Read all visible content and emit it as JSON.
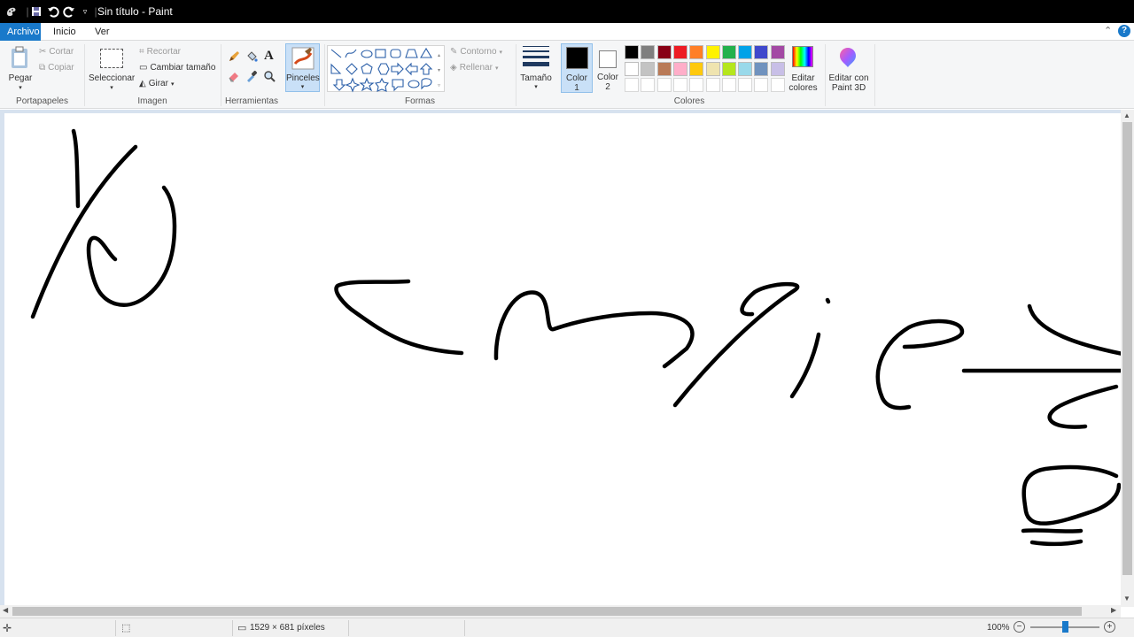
{
  "window": {
    "title": "Sin título - Paint"
  },
  "tabs": [
    {
      "label": "Archivo"
    },
    {
      "label": "Inicio"
    },
    {
      "label": "Ver"
    }
  ],
  "clipboard": {
    "paste": "Pegar",
    "cut": "Cortar",
    "copy": "Copiar",
    "group": "Portapapeles"
  },
  "image": {
    "select": "Seleccionar",
    "crop": "Recortar",
    "resize": "Cambiar tamaño",
    "rotate": "Girar",
    "group": "Imagen"
  },
  "tools": {
    "group": "Herramientas",
    "text_glyph": "A"
  },
  "brushes": {
    "label": "Pinceles"
  },
  "shapes": {
    "outline": "Contorno",
    "fill": "Rellenar",
    "group": "Formas"
  },
  "size": {
    "label": "Tamaño"
  },
  "colors": {
    "color1_line1": "Color",
    "color1_line2": "1",
    "color2_line1": "Color",
    "color2_line2": "2",
    "edit_line1": "Editar",
    "edit_line2": "colores",
    "group": "Colores",
    "color1": "#000000",
    "color2": "#ffffff",
    "palette": [
      [
        "#000000",
        "#7f7f7f",
        "#880015",
        "#ed1c24",
        "#ff7f27",
        "#fff200",
        "#22b14c",
        "#00a2e8",
        "#3f48cc",
        "#a349a4"
      ],
      [
        "#ffffff",
        "#c3c3c3",
        "#b97a57",
        "#ffaec9",
        "#ffc90e",
        "#efe4b0",
        "#b5e61d",
        "#99d9ea",
        "#7092be",
        "#c8bfe7"
      ],
      [
        "#ffffff",
        "#ffffff",
        "#ffffff",
        "#ffffff",
        "#ffffff",
        "#ffffff",
        "#ffffff",
        "#ffffff",
        "#ffffff",
        "#ffffff"
      ]
    ]
  },
  "paint3d": {
    "line1": "Editar con",
    "line2": "Paint 3D"
  },
  "status": {
    "dimensions": "1529 × 681 píxeles",
    "zoom": "100%"
  }
}
